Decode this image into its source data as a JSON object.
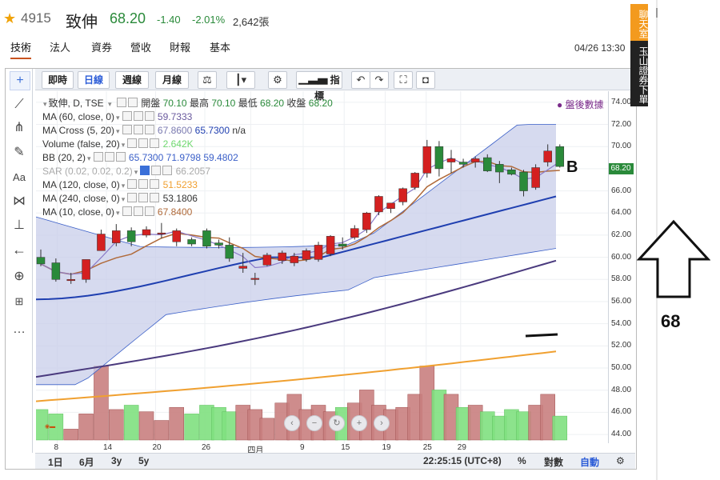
{
  "header": {
    "code": "4915",
    "name": "致伸",
    "price": "68.20",
    "change": "-1.40",
    "change_pct": "-2.01%",
    "volume": "2,642張",
    "up_color": "#d42020",
    "down_color": "#2a8a3a"
  },
  "tabs": [
    {
      "label": "技術",
      "active": true
    },
    {
      "label": "法人",
      "active": false
    },
    {
      "label": "資券",
      "active": false
    },
    {
      "label": "營收",
      "active": false
    },
    {
      "label": "財報",
      "active": false
    },
    {
      "label": "基本",
      "active": false
    }
  ],
  "datetime": "04/26 13:30",
  "toolbar": {
    "intraday": "即時",
    "daily": "日線",
    "weekly": "週線",
    "monthly": "月線",
    "compare_icon": "scale-icon",
    "candle_icon": "candlestick-icon",
    "settings_icon": "gear-icon",
    "indicators": "指標",
    "undo_icon": "undo-icon",
    "redo_icon": "redo-icon",
    "fullscreen_icon": "fullscreen-icon",
    "snapshot_icon": "camera-icon"
  },
  "left_tools": [
    "crosshair-icon",
    "trendline-icon",
    "fork-icon",
    "brush-icon",
    "text-icon",
    "pattern-icon",
    "measure-icon",
    "arrow-left-icon",
    "zoom-icon",
    "ruler-icon",
    "more-icon"
  ],
  "legend": {
    "main": {
      "label": "致伸, D, TSE",
      "o_label": "開盤",
      "o": "70.10",
      "h_label": "最高",
      "h": "70.10",
      "l_label": "最低",
      "l": "68.20",
      "c_label": "收盤",
      "c": "68.20"
    },
    "after_hours": "盤後數據",
    "studies": [
      {
        "label": "MA (60, close, 0)",
        "value": "59.7333",
        "color": "#6a5a9e"
      },
      {
        "label": "MA Cross (5, 20)",
        "value": "67.8600",
        "value2": "65.7300",
        "value3": "n/a",
        "color": "#7a7ab0"
      },
      {
        "label": "Volume (false, 20)",
        "value": "2.642K",
        "color": "#7fe07f"
      },
      {
        "label": "BB (20, 2)",
        "value": "65.7300",
        "value2": "71.9798",
        "value3": "59.4802",
        "color": "#3a5fc8"
      },
      {
        "label": "SAR (0.02, 0.02, 0.2)",
        "value": "66.2057",
        "color": "#aaaaaa"
      },
      {
        "label": "MA (120, close, 0)",
        "value": "51.5233",
        "color": "#f0a030"
      },
      {
        "label": "MA (240, close, 0)",
        "value": "53.1806",
        "color": "#333333"
      },
      {
        "label": "MA (10, close, 0)",
        "value": "67.8400",
        "color": "#b06a3a"
      }
    ]
  },
  "chart_data": {
    "type": "candlestick",
    "ylim": [
      43.5,
      75.0
    ],
    "y_ticks": [
      "74.00",
      "72.00",
      "70.00",
      "68.00",
      "66.00",
      "64.00",
      "62.00",
      "60.00",
      "58.00",
      "56.00",
      "54.00",
      "52.00",
      "50.00",
      "48.00",
      "46.00",
      "44.00"
    ],
    "last_price_label": "68.20",
    "x_labels": [
      "8",
      "14",
      "20",
      "26",
      "四月",
      "9",
      "15",
      "19",
      "25",
      "29"
    ],
    "x_label_index": [
      2,
      8,
      14,
      20,
      25.6,
      32,
      37,
      42,
      47,
      51.2
    ],
    "candles": [
      {
        "o": 60.0,
        "h": 60.7,
        "l": 59.2,
        "c": 59.4
      },
      {
        "o": 59.5,
        "h": 59.9,
        "l": 57.8,
        "c": 58.0
      },
      {
        "o": 58.0,
        "h": 58.6,
        "l": 57.6,
        "c": 58.0
      },
      {
        "o": 58.0,
        "h": 59.8,
        "l": 57.7,
        "c": 59.8
      },
      {
        "o": 60.6,
        "h": 62.5,
        "l": 60.6,
        "c": 62.1
      },
      {
        "o": 61.3,
        "h": 63.0,
        "l": 61.0,
        "c": 62.4
      },
      {
        "o": 62.4,
        "h": 62.7,
        "l": 61.0,
        "c": 61.4
      },
      {
        "o": 62.0,
        "h": 62.8,
        "l": 61.8,
        "c": 62.5
      },
      {
        "o": 62.2,
        "h": 63.1,
        "l": 61.7,
        "c": 62.2
      },
      {
        "o": 61.4,
        "h": 62.6,
        "l": 61.0,
        "c": 62.4
      },
      {
        "o": 61.6,
        "h": 61.8,
        "l": 61.0,
        "c": 61.2
      },
      {
        "o": 62.4,
        "h": 62.6,
        "l": 60.8,
        "c": 61.0
      },
      {
        "o": 61.3,
        "h": 61.6,
        "l": 60.8,
        "c": 61.1
      },
      {
        "o": 61.1,
        "h": 61.8,
        "l": 59.6,
        "c": 59.9
      },
      {
        "o": 59.0,
        "h": 60.4,
        "l": 58.6,
        "c": 59.2
      },
      {
        "o": 58.0,
        "h": 58.6,
        "l": 57.5,
        "c": 58.1
      },
      {
        "o": 59.3,
        "h": 60.4,
        "l": 59.2,
        "c": 60.2
      },
      {
        "o": 59.7,
        "h": 60.6,
        "l": 59.4,
        "c": 60.4
      },
      {
        "o": 59.5,
        "h": 60.4,
        "l": 59.2,
        "c": 60.1
      },
      {
        "o": 59.8,
        "h": 60.8,
        "l": 59.6,
        "c": 60.6
      },
      {
        "o": 59.8,
        "h": 61.4,
        "l": 59.6,
        "c": 61.1
      },
      {
        "o": 60.3,
        "h": 62.0,
        "l": 60.1,
        "c": 61.9
      },
      {
        "o": 61.2,
        "h": 61.8,
        "l": 60.7,
        "c": 61.0
      },
      {
        "o": 61.8,
        "h": 62.9,
        "l": 61.6,
        "c": 62.6
      },
      {
        "o": 62.5,
        "h": 64.1,
        "l": 62.2,
        "c": 64.0
      },
      {
        "o": 64.1,
        "h": 65.6,
        "l": 63.8,
        "c": 65.5
      },
      {
        "o": 64.4,
        "h": 64.9,
        "l": 64.0,
        "c": 64.9
      },
      {
        "o": 65.0,
        "h": 66.3,
        "l": 64.7,
        "c": 66.2
      },
      {
        "o": 66.3,
        "h": 67.7,
        "l": 66.1,
        "c": 67.6
      },
      {
        "o": 67.6,
        "h": 70.6,
        "l": 67.2,
        "c": 70.0
      },
      {
        "o": 70.0,
        "h": 70.5,
        "l": 67.3,
        "c": 68.0
      },
      {
        "o": 68.6,
        "h": 69.7,
        "l": 67.6,
        "c": 68.9
      },
      {
        "o": 68.6,
        "h": 68.9,
        "l": 68.1,
        "c": 68.4
      },
      {
        "o": 68.6,
        "h": 69.1,
        "l": 68.1,
        "c": 68.9
      },
      {
        "o": 69.0,
        "h": 69.3,
        "l": 67.7,
        "c": 67.8
      },
      {
        "o": 68.4,
        "h": 68.7,
        "l": 66.7,
        "c": 67.7
      },
      {
        "o": 67.9,
        "h": 68.1,
        "l": 67.4,
        "c": 67.5
      },
      {
        "o": 67.7,
        "h": 67.9,
        "l": 65.5,
        "c": 66.0
      },
      {
        "o": 66.3,
        "h": 68.4,
        "l": 66.1,
        "c": 68.1
      },
      {
        "o": 68.6,
        "h": 70.2,
        "l": 68.2,
        "c": 69.6
      },
      {
        "o": 70.0,
        "h": 70.2,
        "l": 68.1,
        "c": 68.2
      }
    ],
    "candle_x_index": [
      0,
      2,
      4,
      6,
      8,
      10,
      12,
      14,
      16,
      18,
      20,
      22,
      23.6,
      25,
      26.8,
      28.4,
      30,
      32,
      33.6,
      35.2,
      36.8,
      38.4,
      40,
      41.6,
      43.2,
      44.8,
      46.4,
      48,
      49.6,
      51.2,
      52.8,
      54.4,
      56,
      57.6,
      59.2,
      60.8,
      62.4,
      64,
      65.6,
      67.2,
      68.8
    ],
    "volume_ylim": [
      0,
      5
    ],
    "volumes": [
      1.4,
      1.2,
      0.5,
      1.2,
      3.4,
      1.4,
      1.6,
      1.3,
      0.9,
      1.5,
      1.2,
      1.6,
      1.5,
      1.3,
      1.6,
      1.4,
      1.0,
      1.7,
      2.1,
      1.4,
      1.6,
      1.3,
      1.5,
      1.7,
      2.3,
      1.6,
      1.4,
      1.5,
      2.1,
      3.4,
      2.3,
      2.1,
      1.5,
      1.6,
      1.3,
      1.1,
      1.4,
      1.3,
      1.6,
      2.1,
      1.1
    ]
  },
  "axis_bottom": {
    "periods": [
      "1日",
      "6月",
      "3y",
      "5y"
    ],
    "clock": "22:25:15 (UTC+8)",
    "percent": "%",
    "log": "對數",
    "auto": "自動",
    "settings_icon": "gear-icon"
  },
  "sidebar_right": {
    "chat_label": "聊天室",
    "esun_label": "玉山證券下單"
  },
  "annotations": {
    "b_label": "B",
    "target_label": "68"
  }
}
